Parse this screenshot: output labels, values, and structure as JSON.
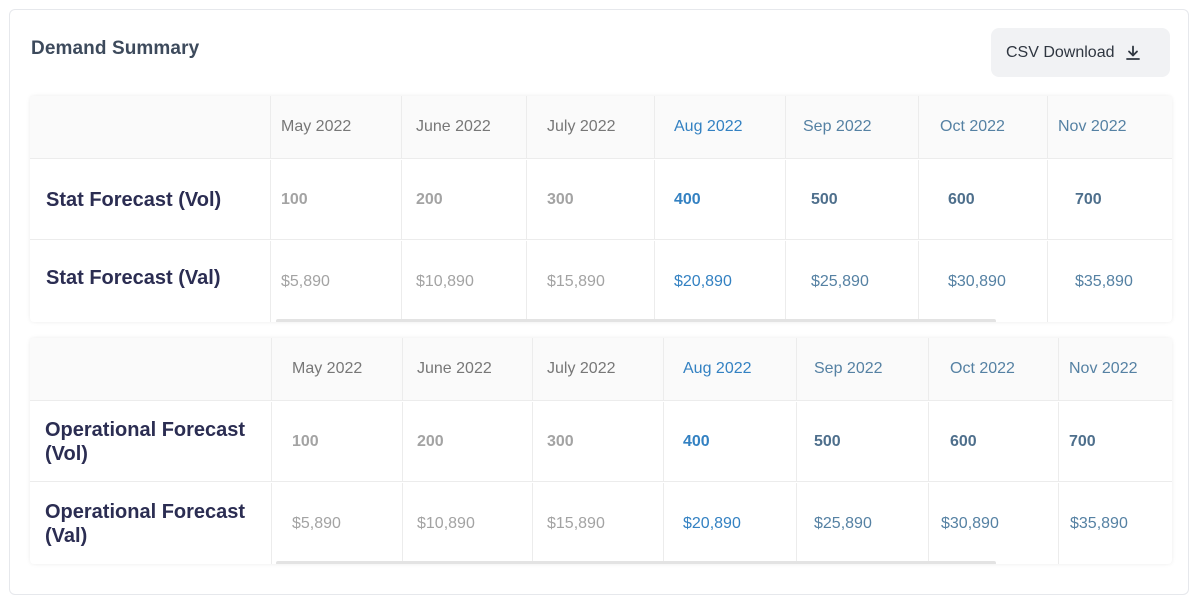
{
  "title": "Demand Summary",
  "csv_button": {
    "label": "CSV Download",
    "icon": "download-icon"
  },
  "colors": {
    "past_month": "#a3a3a3",
    "current_month": "#3381c2",
    "future_month": "#5581a3"
  },
  "tables": [
    {
      "months": [
        "May 2022",
        "June 2022",
        "July 2022",
        "Aug 2022",
        "Sep 2022",
        "Oct 2022",
        "Nov 2022"
      ],
      "rows": [
        {
          "label": "Stat Forecast (Vol)",
          "values": [
            "100",
            "200",
            "300",
            "400",
            "500",
            "600",
            "700"
          ]
        },
        {
          "label": "Stat Forecast (Val)",
          "values": [
            "$5,890",
            "$10,890",
            "$15,890",
            "$20,890",
            "$25,890",
            "$30,890",
            "$35,890"
          ]
        }
      ]
    },
    {
      "months": [
        "May 2022",
        "June 2022",
        "July 2022",
        "Aug 2022",
        "Sep 2022",
        "Oct 2022",
        "Nov 2022"
      ],
      "rows": [
        {
          "label": "Operational Forecast (Vol)",
          "values": [
            "100",
            "200",
            "300",
            "400",
            "500",
            "600",
            "700"
          ]
        },
        {
          "label": "Operational Forecast (Val)",
          "values": [
            "$5,890",
            "$10,890",
            "$15,890",
            "$20,890",
            "$25,890",
            "$30,890",
            "$35,890"
          ]
        }
      ]
    }
  ]
}
